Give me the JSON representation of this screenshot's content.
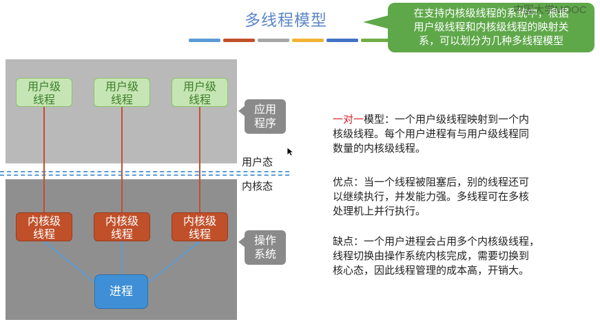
{
  "title": "多线程模型",
  "stripes": [
    "#5b9bd5",
    "#c0502a",
    "#a5a5a5",
    "#f1b335",
    "#4472c4",
    "#70ad47"
  ],
  "callout": {
    "line1": "在支持内核级线程的系统中，根据",
    "line2": "用户级线程和内核级线程的映射关",
    "line3": "系，可以划分为几种多线程模型"
  },
  "watermark": "中国大学MOOC",
  "diagram": {
    "user_threads": [
      {
        "l1": "用户级",
        "l2": "线程"
      },
      {
        "l1": "用户级",
        "l2": "线程"
      },
      {
        "l1": "用户级",
        "l2": "线程"
      }
    ],
    "kernel_threads": [
      {
        "l1": "内核级",
        "l2": "线程"
      },
      {
        "l1": "内核级",
        "l2": "线程"
      },
      {
        "l1": "内核级",
        "l2": "线程"
      }
    ],
    "process": "进程",
    "app_label": {
      "l1": "应用",
      "l2": "程序"
    },
    "os_label": {
      "l1": "操作",
      "l2": "系统"
    },
    "user_mode": "用户态",
    "kernel_mode": "内核态"
  },
  "text": {
    "model_name": "一对一",
    "p1_rest_line1": "模型：一个用户级线程映射到一个内",
    "p1_line2": "核级线程。每个用户进程有与用户级线程同",
    "p1_line3": "数量的内核级线程。",
    "p2_line1": "优点：当一个线程被阻塞后，别的线程还可",
    "p2_line2": "以继续执行，并发能力强。多线程可在多核",
    "p2_line3": "处理机上并行执行。",
    "p3_line1": "缺点：一个用户进程会占用多个内核级线程，",
    "p3_line2": "线程切换由操作系统内核完成，需要切换到",
    "p3_line3": "核心态，因此线程管理的成本高，开销大。"
  }
}
